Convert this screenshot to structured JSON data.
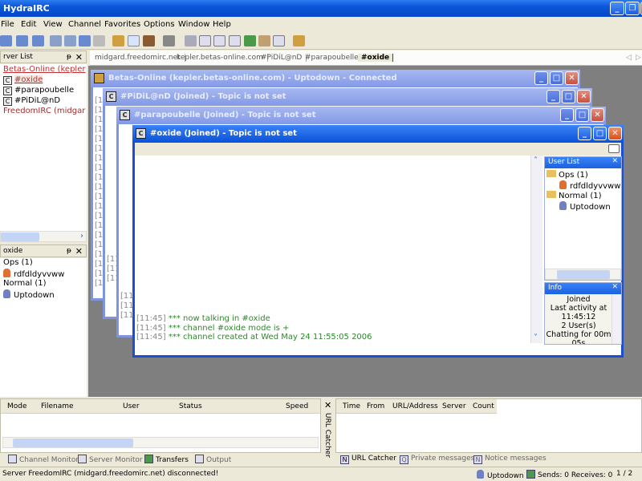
{
  "app": {
    "title": "HydraIRC"
  },
  "menu": [
    "File",
    "Edit",
    "View",
    "Channel",
    "Favorites",
    "Options",
    "Window",
    "Help"
  ],
  "server_list": {
    "title": "rver List",
    "items": [
      {
        "label": "Betas-Online (kepler",
        "type": "server",
        "active": true
      },
      {
        "label": "#oxide",
        "type": "channel",
        "active": true
      },
      {
        "label": "#parapoubelle",
        "type": "channel"
      },
      {
        "label": "#PiDiL@nD",
        "type": "channel"
      },
      {
        "label": "FreedomIRC (midgar",
        "type": "server"
      }
    ]
  },
  "channel_panel": {
    "title": "oxide",
    "groups": [
      {
        "label": "Ops (1)",
        "users": [
          "rdfdldyvvww"
        ]
      },
      {
        "label": "Normal (1)",
        "users": [
          "Uptodown"
        ]
      }
    ]
  },
  "tabs": [
    {
      "label": "midgard.freedomirc.net"
    },
    {
      "label": "kepler.betas-online.com"
    },
    {
      "label": "#PiDiL@nD"
    },
    {
      "label": "#parapoubelle"
    },
    {
      "label": "#oxide",
      "active": true
    }
  ],
  "windows": [
    {
      "title": "Betas-Online (kepler.betas-online.com) - Uptodown - Connected",
      "stamp": "[11"
    },
    {
      "title": "#PiDiL@nD (Joined) - Topic is not set",
      "stamp": "[11:"
    },
    {
      "title": "#parapoubelle (Joined) - Topic is not set",
      "stamp": "[11:"
    },
    {
      "title": "#oxide (Joined) - Topic is not set"
    }
  ],
  "chat": [
    {
      "time": "[11:45]",
      "text": "*** now talking in #oxide"
    },
    {
      "time": "[11:45]",
      "text": "*** channel #oxide mode is +"
    },
    {
      "time": "[11:45]",
      "text": "*** channel created at Wed May 24 11:55:05 2006"
    }
  ],
  "user_list": {
    "title": "User List",
    "groups": [
      {
        "label": "Ops (1)",
        "users": [
          "rdfdldyvvww"
        ]
      },
      {
        "label": "Normal (1)",
        "users": [
          "Uptodown"
        ]
      }
    ]
  },
  "info": {
    "title": "Info",
    "lines": [
      "Joined",
      "Last activity at",
      "11:45:12",
      "2 User(s)",
      "Chatting for 00m",
      "05s"
    ]
  },
  "transfers": {
    "columns": [
      "Mode",
      "Filename",
      "User",
      "Status",
      "Speed"
    ]
  },
  "bottom_left_tabs": [
    {
      "label": "Channel Monitor"
    },
    {
      "label": "Server Monitor"
    },
    {
      "label": "Transfers",
      "active": true
    },
    {
      "label": "Output"
    }
  ],
  "url_catcher": {
    "side_label": "URL Catcher",
    "columns": [
      "Time",
      "From",
      "URL/Address",
      "Server",
      "Count"
    ]
  },
  "bottom_right_tabs": [
    {
      "label": "URL Catcher",
      "active": true
    },
    {
      "label": "Private messages"
    },
    {
      "label": "Notice messages"
    }
  ],
  "status": {
    "message": "Server FreedomIRC (midgard.freedomirc.net) disconnected!",
    "nick": "Uptodown",
    "transfers": "Sends: 0 Receives: 0",
    "page": "1 / 2"
  },
  "colors": {
    "title_bar": "#0a55d8",
    "server_active": "#c03030",
    "chat_text": "#2a8a2a"
  }
}
